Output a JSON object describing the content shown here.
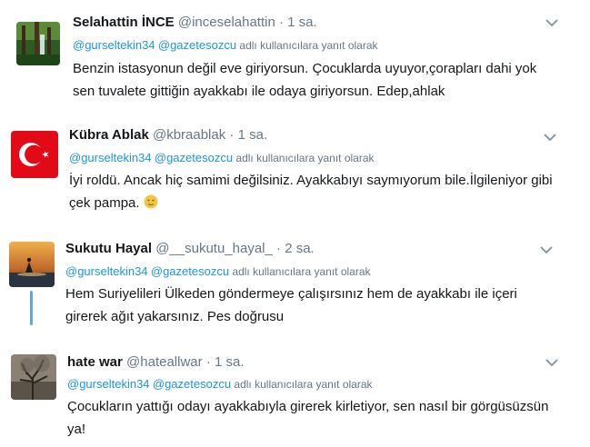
{
  "tweets": [
    {
      "name": "Selahattin İNCE",
      "handle": "@inceselahattin",
      "time": "1 sa.",
      "mention1": "@gurseltekin34",
      "mention2": "@gazetesozcu",
      "reply_suffix": "adlı kullanıcılara yanıt olarak",
      "text_line1": "Benzin istasyonun değil eve giriyorsun. Çocuklarda uyuyor,çorapları dahi yok",
      "text_line2": "sen tuvalete gittiğin ayakkabı ile odaya giriyorsun. Edep,ahlak",
      "avatar": "forest-avatar"
    },
    {
      "name": "Kübra Ablak",
      "handle": "@kbraablak",
      "time": "1 sa.",
      "mention1": "@gurseltekin34",
      "mention2": "@gazetesozcu",
      "reply_suffix": "adlı kullanıcılara yanıt olarak",
      "text_line1": "İyi roldü. Ancak hiç samimi değilsiniz. Ayakkabıyı saymıyorum bile.İlgileniyor gibi",
      "text_line2": "çek pampa.",
      "emoji": "slightly-smiling-face-emoji",
      "avatar": "turkish-flag-avatar"
    },
    {
      "name": "Sukutu Hayal",
      "handle": "@__sukutu_hayal_",
      "time": "2 sa.",
      "mention1": "@gurseltekin34",
      "mention2": "@gazetesozcu",
      "reply_suffix": "adlı kullanıcılara yanıt olarak",
      "text_line1": "Hem Suriyelileri Ülkeden göndermeye çalışırsınız hem de ayakkabı ile içeri",
      "text_line2": "girerek ağıt yakarsınız. Pes doğrusu",
      "avatar": "sunset-avatar"
    },
    {
      "name": "hate war",
      "handle": "@hateallwar",
      "time": "1 sa.",
      "mention1": "@gurseltekin34",
      "mention2": "@gazetesozcu",
      "reply_suffix": "adlı kullanıcılara yanıt olarak",
      "text_line1": "Çocukların yattığı odayı ayakkabıyla girerek kirletiyor, sen nasıl bir görgüsüzsün",
      "text_line2": "ya!",
      "avatar": "tree-avatar"
    }
  ],
  "ui": {
    "dot": "·",
    "more_icon": "chevron-down-icon"
  }
}
